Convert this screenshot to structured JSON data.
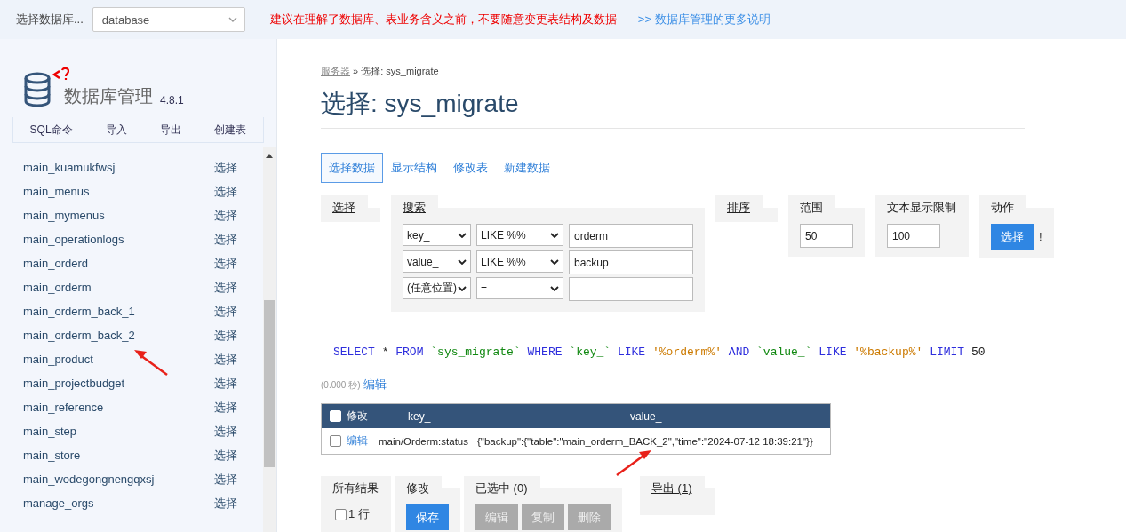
{
  "top_bar": {
    "db_label": "选择数据库...",
    "db_select": "database",
    "warning": "建议在理解了数据库、表业务含义之前，不要随意变更表结构及数据",
    "help_link": ">> 数据库管理的更多说明"
  },
  "sidebar": {
    "title": "数据库管理",
    "version": "4.8.1",
    "menu": [
      "SQL命令",
      "导入",
      "导出",
      "创建表"
    ],
    "tables": [
      {
        "name": "main_kuamukfwsj",
        "action": "选择"
      },
      {
        "name": "main_menus",
        "action": "选择"
      },
      {
        "name": "main_mymenus",
        "action": "选择"
      },
      {
        "name": "main_operationlogs",
        "action": "选择"
      },
      {
        "name": "main_orderd",
        "action": "选择"
      },
      {
        "name": "main_orderm",
        "action": "选择"
      },
      {
        "name": "main_orderm_back_1",
        "action": "选择"
      },
      {
        "name": "main_orderm_back_2",
        "action": "选择"
      },
      {
        "name": "main_product",
        "action": "选择"
      },
      {
        "name": "main_projectbudget",
        "action": "选择"
      },
      {
        "name": "main_reference",
        "action": "选择"
      },
      {
        "name": "main_step",
        "action": "选择"
      },
      {
        "name": "main_store",
        "action": "选择"
      },
      {
        "name": "main_wodegongnengqxsj",
        "action": "选择"
      },
      {
        "name": "manage_orgs",
        "action": "选择"
      }
    ]
  },
  "breadcrumb": {
    "link": "服务器",
    "rest": "» 选择: sys_migrate"
  },
  "heading": {
    "prefix": "选择:",
    "table": "sys_migrate"
  },
  "tabs": [
    {
      "label": "选择数据",
      "selected": true
    },
    {
      "label": "显示结构",
      "selected": false
    },
    {
      "label": "修改表",
      "selected": false
    },
    {
      "label": "新建数据",
      "selected": false
    }
  ],
  "filters": {
    "select_legend": "选择",
    "search_legend": "搜索",
    "search_rows": [
      {
        "column": "key_",
        "operator": "LIKE %%",
        "value": "orderm"
      },
      {
        "column": "value_",
        "operator": "LIKE %%",
        "value": "backup"
      },
      {
        "column": "(任意位置)",
        "operator": "="
      }
    ],
    "sort_legend": "排序",
    "limit_legend": "范围",
    "limit": "50",
    "text_legend": "文本显示限制",
    "text_limit": "100",
    "action_legend": "动作",
    "action_button": "选择",
    "action_mark": "!"
  },
  "sql": [
    {
      "kind": "keyword",
      "text": "SELECT"
    },
    {
      "kind": "plain",
      "text": "*"
    },
    {
      "kind": "keyword",
      "text": "FROM"
    },
    {
      "kind": "ident",
      "text": "`sys_migrate`"
    },
    {
      "kind": "keyword",
      "text": "WHERE"
    },
    {
      "kind": "ident",
      "text": "`key_`"
    },
    {
      "kind": "keyword",
      "text": "LIKE"
    },
    {
      "kind": "string",
      "text": "'%orderm%'"
    },
    {
      "kind": "keyword",
      "text": "AND"
    },
    {
      "kind": "ident",
      "text": "`value_`"
    },
    {
      "kind": "keyword",
      "text": "LIKE"
    },
    {
      "kind": "string",
      "text": "'%backup%'"
    },
    {
      "kind": "keyword",
      "text": "LIMIT"
    },
    {
      "kind": "plain",
      "text": "50"
    }
  ],
  "timing": {
    "time": "(0.000 秒)",
    "edit": "编辑"
  },
  "table": {
    "all_checked": false,
    "columns": [
      "修改",
      "key_",
      "value_"
    ],
    "rows": [
      {
        "checked": false,
        "edit": "编辑",
        "key": "main/Orderm:status",
        "value": "{\"backup\":{\"table\":\"main_orderm_BACK_2\",\"time\":\"2024-07-12 18:39:21\"}}"
      }
    ]
  },
  "bottom": {
    "all_legend": "所有结果",
    "all_checked": false,
    "all_label": "1 行",
    "modify_legend": "修改",
    "save": "保存",
    "selected_legend": "已选中 (0)",
    "selected_buttons": [
      {
        "label": "编辑",
        "disabled": true
      },
      {
        "label": "复制",
        "disabled": true
      },
      {
        "label": "删除",
        "disabled": true
      }
    ],
    "export_legend": "导出 (1)"
  }
}
